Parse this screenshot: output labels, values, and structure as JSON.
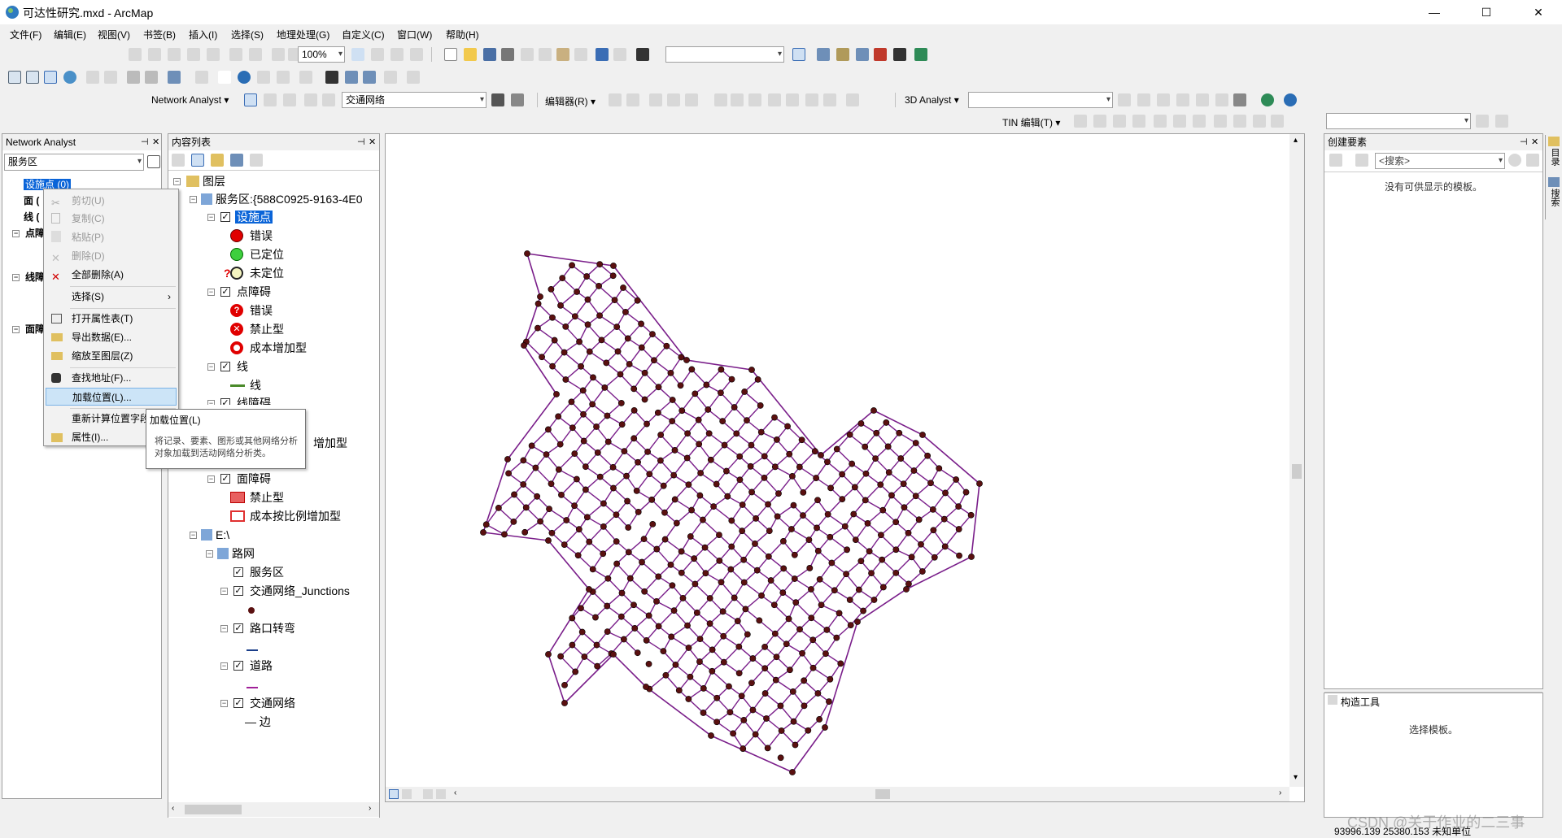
{
  "window": {
    "title": "可达性研究.mxd - ArcMap",
    "minimize": "—",
    "maximize": "☐",
    "close": "✕"
  },
  "menus": [
    "文件(F)",
    "编辑(E)",
    "视图(V)",
    "书签(B)",
    "插入(I)",
    "选择(S)",
    "地理处理(G)",
    "自定义(C)",
    "窗口(W)",
    "帮助(H)"
  ],
  "toolbar": {
    "zoom_value": "100%",
    "network_analyst_label": "Network Analyst ▾",
    "network_dataset": "交通网络",
    "editor_label": "编辑器(R) ▾",
    "analyst3d_label": "3D Analyst ▾",
    "tin_label": "TIN 编辑(T) ▾"
  },
  "network_panel": {
    "title": "Network Analyst",
    "dropdown_value": "服务区",
    "items": [
      "设施点 (0)",
      "面 (",
      "线 (",
      "点障",
      "线障",
      "面障"
    ]
  },
  "context_menu": {
    "items": [
      {
        "label": "剪切(U)",
        "disabled": true
      },
      {
        "label": "复制(C)",
        "disabled": true
      },
      {
        "label": "粘贴(P)",
        "disabled": true
      },
      {
        "label": "删除(D)",
        "disabled": true
      },
      {
        "label": "全部删除(A)",
        "disabled": false
      },
      {
        "label": "选择(S)",
        "disabled": false
      },
      {
        "label": "打开属性表(T)",
        "disabled": false
      },
      {
        "label": "导出数据(E)...",
        "disabled": false
      },
      {
        "label": "缩放至图层(Z)",
        "disabled": false
      },
      {
        "label": "查找地址(F)...",
        "disabled": false
      },
      {
        "label": "加载位置(L)...",
        "disabled": false
      },
      {
        "label": "重新计算位置字段",
        "disabled": false
      },
      {
        "label": "属性(I)...",
        "disabled": false
      }
    ],
    "submenu_arrow": "›"
  },
  "tooltip": {
    "title": "加载位置(L)",
    "body": "将记录、要素、图形或其他网络分析对象加载到活动网络分析类。"
  },
  "toc": {
    "title": "内容列表",
    "layers_root": "图层",
    "service_area": "服务区:{588C0925-9163-4E0",
    "facilities": "设施点",
    "fac_error": "错误",
    "fac_located": "已定位",
    "fac_unlocated": "未定位",
    "point_barriers": "点障碍",
    "pb_error": "错误",
    "pb_restriction": "禁止型",
    "pb_cost": "成本增加型",
    "lines": "线",
    "lines_sub": "线",
    "line_barriers": "线障碍",
    "lb_cost_partial": "增加型",
    "polygon_barriers": "面障碍",
    "plb_restriction": "禁止型",
    "plb_scaled": "成本按比例增加型",
    "drive": "E:\\",
    "road_network": "路网",
    "service_area_layer": "服务区",
    "junctions": "交通网络_Junctions",
    "turns": "路口转弯",
    "roads": "道路",
    "network": "交通网络",
    "edges": "— 边"
  },
  "create_features": {
    "title": "创建要素",
    "search_placeholder": "<搜索>",
    "no_templates": "没有可供显示的模板。",
    "construction_tools": "构造工具",
    "select_template": "选择模板。"
  },
  "side_tabs": [
    "目录",
    "搜索"
  ],
  "status": {
    "coords": "93996.139  25380.153 未知单位",
    "watermark": "CSDN @关于作业的二三事"
  },
  "colors": {
    "road": "#7a1e8a",
    "junction": "#5a1010",
    "selection": "#0a64d8"
  }
}
